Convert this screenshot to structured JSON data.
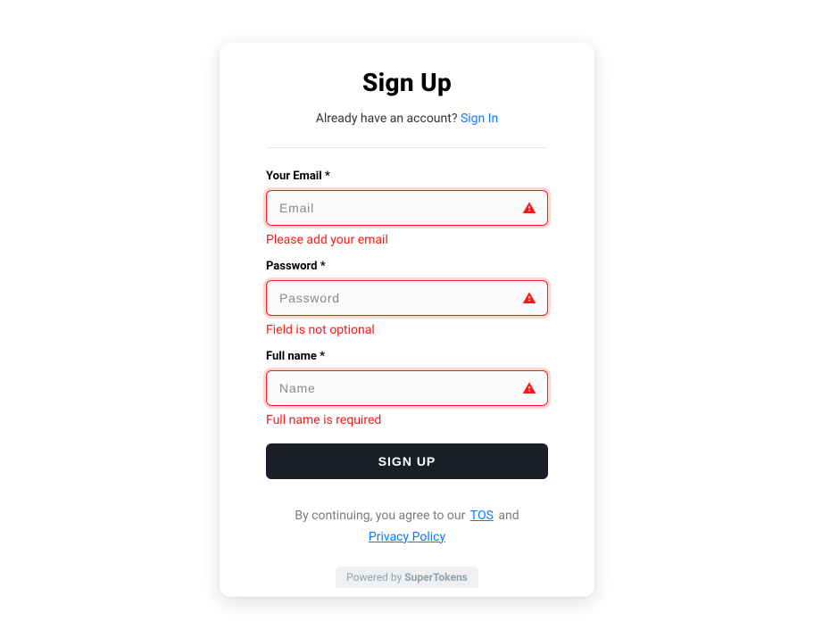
{
  "header": {
    "title": "Sign Up",
    "subtitle_prefix": "Already have an account? ",
    "signin_link": "Sign In"
  },
  "fields": {
    "email": {
      "label": "Your Email *",
      "placeholder": "Email",
      "value": "",
      "error": "Please add your email"
    },
    "password": {
      "label": "Password *",
      "placeholder": "Password",
      "value": "",
      "error": "Field is not optional"
    },
    "fullname": {
      "label": "Full name *",
      "placeholder": "Name",
      "value": "",
      "error": "Full name is required"
    }
  },
  "submit_label": "SIGN UP",
  "consent": {
    "prefix": "By continuing, you agree to our ",
    "tos": "TOS",
    "middle": " and ",
    "privacy": "Privacy Policy"
  },
  "powered": {
    "prefix": "Powered by ",
    "brand": "SuperTokens"
  },
  "colors": {
    "error": "#ff1717",
    "link": "#0b7bff",
    "button_bg": "#1a1f27"
  }
}
